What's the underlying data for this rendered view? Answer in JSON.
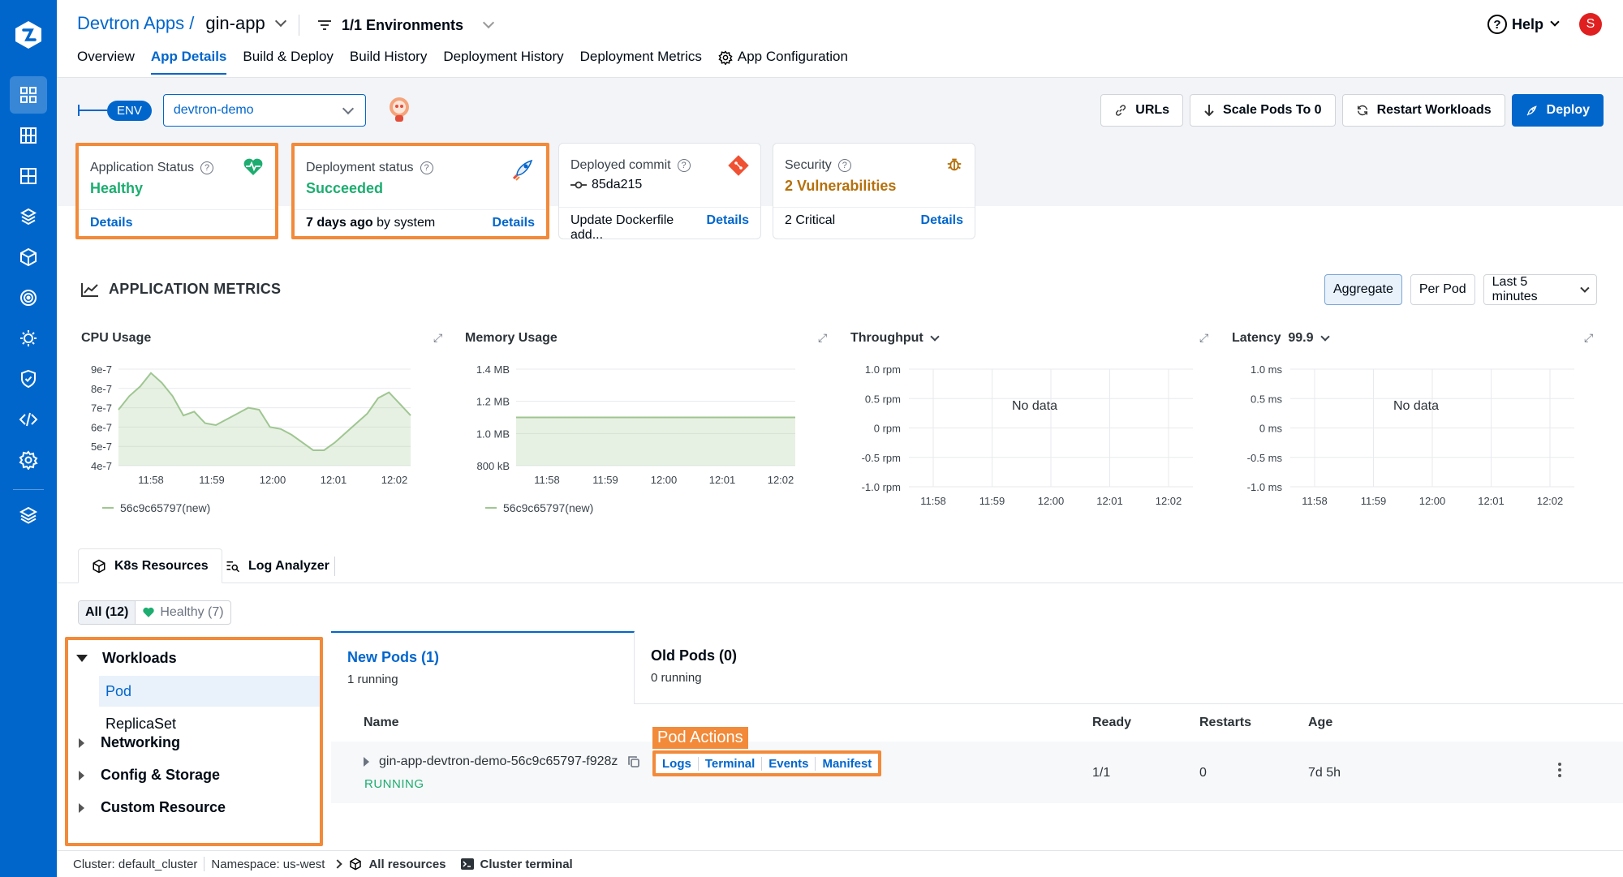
{
  "app": {
    "title_prefix": "Devtron Apps /",
    "app_name": "gin-app",
    "env_filter": "1/1 Environments"
  },
  "header": {
    "tabs": [
      "Overview",
      "App Details",
      "Build & Deploy",
      "Build History",
      "Deployment History",
      "Deployment Metrics",
      "App Configuration"
    ],
    "active_tab": "App Details",
    "help_label": "Help",
    "avatar_initial": "S"
  },
  "env": {
    "pill": "ENV",
    "selected": "devtron-demo"
  },
  "actions": {
    "urls": "URLs",
    "scale": "Scale Pods To 0",
    "restart": "Restart Workloads",
    "deploy": "Deploy"
  },
  "cards": {
    "app_status": {
      "title": "Application Status",
      "value": "Healthy",
      "link": "Details"
    },
    "deploy_status": {
      "title": "Deployment status",
      "value": "Succeeded",
      "time": "7 days ago",
      "by": "by system",
      "link": "Details"
    },
    "commit": {
      "title": "Deployed commit",
      "hash": "85da215",
      "message": "Update Dockerfile add...",
      "link": "Details"
    },
    "security": {
      "title": "Security",
      "value": "2 Vulnerabilities",
      "critical": "2 Critical",
      "link": "Details"
    }
  },
  "metrics": {
    "title": "APPLICATION METRICS",
    "aggregate": "Aggregate",
    "per_pod": "Per Pod",
    "range": "Last 5 minutes",
    "cpu_title": "CPU Usage",
    "mem_title": "Memory Usage",
    "thr_title": "Throughput",
    "lat_title": "Latency",
    "lat_pct": "99.9",
    "no_data": "No data",
    "legend": "56c9c65797(new)",
    "cpu_yticks": [
      "9e-7",
      "8e-7",
      "7e-7",
      "6e-7",
      "5e-7",
      "4e-7"
    ],
    "mem_yticks": [
      "1.4 MB",
      "1.2 MB",
      "1.0 MB",
      "800 kB"
    ],
    "thr_yticks": [
      "1.0 rpm",
      "0.5 rpm",
      "0 rpm",
      "-0.5 rpm",
      "-1.0 rpm"
    ],
    "lat_yticks": [
      "1.0 ms",
      "0.5 ms",
      "0 ms",
      "-0.5 ms",
      "-1.0 ms"
    ],
    "xticks": [
      "11:58",
      "11:59",
      "12:00",
      "12:01",
      "12:02"
    ]
  },
  "chart_data": [
    {
      "type": "area",
      "title": "CPU Usage",
      "x": [
        "11:57:50",
        "11:58",
        "11:58:10",
        "11:58:20",
        "11:58:30",
        "11:58:40",
        "11:58:50",
        "11:59",
        "11:59:10",
        "11:59:20",
        "11:59:30",
        "11:59:40",
        "11:59:50",
        "12:00",
        "12:00:10",
        "12:00:20",
        "12:00:30",
        "12:00:40",
        "12:00:50",
        "12:01",
        "12:01:10",
        "12:01:20",
        "12:01:30",
        "12:01:40",
        "12:01:50",
        "12:02",
        "12:02:10",
        "12:02:20"
      ],
      "series": [
        {
          "name": "56c9c65797(new)",
          "values": [
            6.9e-07,
            7.6e-07,
            8.1e-07,
            8.8e-07,
            8.3e-07,
            7.6e-07,
            6.6e-07,
            6.8e-07,
            6.2e-07,
            6.1e-07,
            6.4e-07,
            6.7e-07,
            7e-07,
            6.9e-07,
            6e-07,
            5.9e-07,
            5.6e-07,
            5.2e-07,
            4.8e-07,
            4.8e-07,
            5.2e-07,
            5.7e-07,
            6.2e-07,
            6.7e-07,
            7.5e-07,
            7.8e-07,
            7.2e-07,
            6.6e-07
          ]
        }
      ],
      "ylim": [
        4e-07,
        9e-07
      ]
    },
    {
      "type": "area",
      "title": "Memory Usage",
      "x": [
        "11:58",
        "11:59",
        "12:00",
        "12:01",
        "12:02"
      ],
      "series": [
        {
          "name": "56c9c65797(new)",
          "values": [
            1100000,
            1100000,
            1100000,
            1100000,
            1100000
          ]
        }
      ],
      "ylim": [
        800000,
        1400000
      ]
    }
  ],
  "resources": {
    "tab_k8s": "K8s Resources",
    "tab_log": "Log Analyzer",
    "all": "All (12)",
    "healthy": "Healthy (7)",
    "tree": {
      "workloads": "Workloads",
      "pod": "Pod",
      "replicaset": "ReplicaSet",
      "networking": "Networking",
      "config": "Config & Storage",
      "custom": "Custom Resource"
    }
  },
  "pods": {
    "new_tab": "New Pods (1)",
    "new_sub": "1 running",
    "old_tab": "Old Pods (0)",
    "old_sub": "0 running",
    "cols": {
      "name": "Name",
      "ready": "Ready",
      "restarts": "Restarts",
      "age": "Age"
    },
    "row": {
      "name": "gin-app-devtron-demo-56c9c65797-f928z",
      "status": "RUNNING",
      "ready": "1/1",
      "restarts": "0",
      "age": "7d 5h"
    },
    "actions_label": "Pod Actions",
    "actions": [
      "Logs",
      "Terminal",
      "Events",
      "Manifest"
    ]
  },
  "footer": {
    "cluster": "Cluster: default_cluster",
    "namespace": "Namespace: us-west",
    "all_resources": "All resources",
    "terminal": "Cluster terminal"
  },
  "colors": {
    "brand": "#0066cc",
    "healthy": "#1dad70",
    "warning": "#b5700c",
    "highlight": "#f28a3a",
    "chart": "#9fc691"
  }
}
